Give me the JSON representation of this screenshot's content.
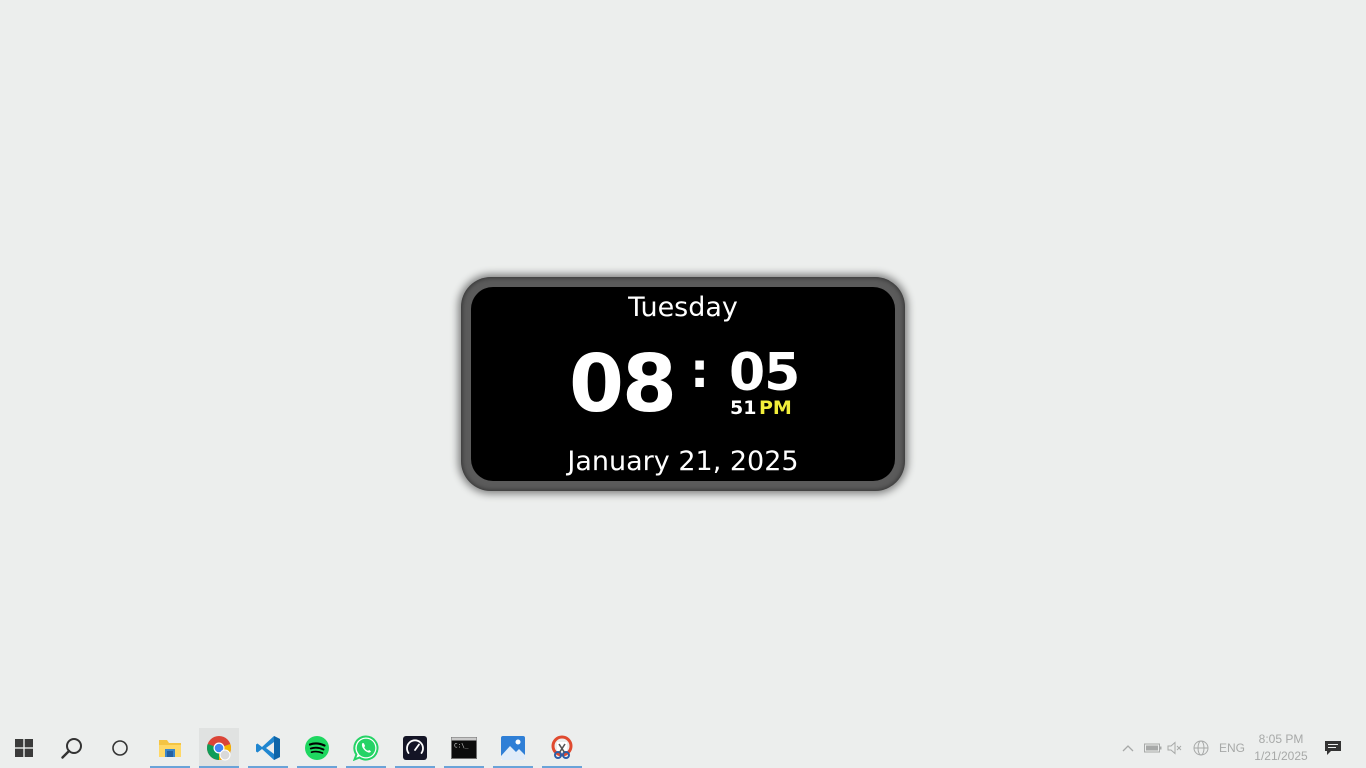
{
  "clock": {
    "day": "Tuesday",
    "hours": "08",
    "separator": ":",
    "minutes": "05",
    "seconds": "51",
    "ampm": "PM",
    "date": "January 21, 2025",
    "ampm_color": "#f2ee3a"
  },
  "taskbar": {
    "start_icon": "windows-start-icon",
    "search_icon": "search-icon",
    "cortana_icon": "cortana-icon",
    "apps": [
      {
        "name": "file-explorer",
        "icon": "folder-icon",
        "active": true
      },
      {
        "name": "chrome",
        "icon": "chrome-icon",
        "active": true
      },
      {
        "name": "vscode",
        "icon": "vscode-icon",
        "active": true
      },
      {
        "name": "spotify",
        "icon": "spotify-icon",
        "active": true
      },
      {
        "name": "whatsapp",
        "icon": "whatsapp-icon",
        "active": true
      },
      {
        "name": "speedtest",
        "icon": "speedometer-icon",
        "active": true
      },
      {
        "name": "command-prompt",
        "icon": "terminal-icon",
        "active": true
      },
      {
        "name": "photos",
        "icon": "photos-icon",
        "active": true
      },
      {
        "name": "snipping-tool",
        "icon": "scissors-icon",
        "active": true
      }
    ],
    "tray": {
      "language": "ENG",
      "time": "8:05 PM",
      "date": "1/21/2025"
    }
  }
}
